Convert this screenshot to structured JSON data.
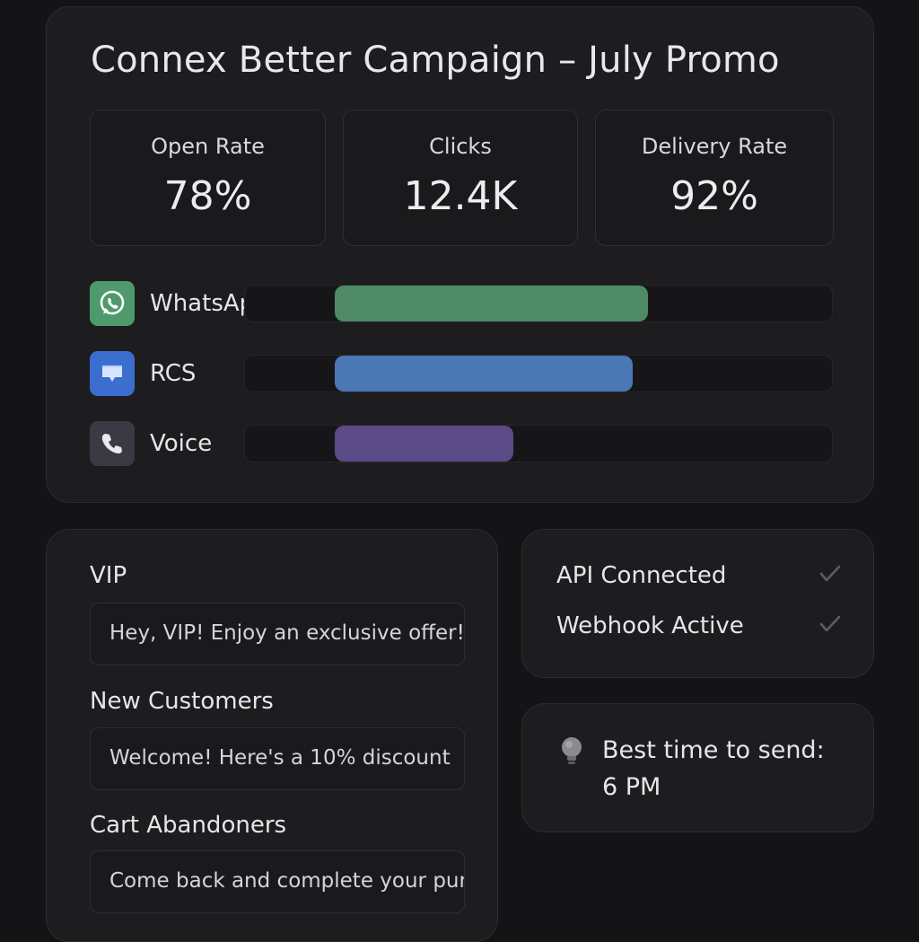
{
  "campaign": {
    "title": "Connex Better Campaign – July Promo",
    "stats": [
      {
        "label": "Open Rate",
        "value": "78%"
      },
      {
        "label": "Clicks",
        "value": "12.4K"
      },
      {
        "label": "Delivery Rate",
        "value": "92%"
      }
    ],
    "channels": [
      {
        "label": "WhatsApp",
        "icon": "whatsapp-icon",
        "level": 0.63,
        "color": "#4e8a66",
        "icon_bg": "#4f9a6c"
      },
      {
        "label": "RCS",
        "icon": "rcs-message-icon",
        "level": 0.6,
        "color": "#4b78b4",
        "icon_bg": "#3c6ed0"
      },
      {
        "label": "Voice",
        "icon": "phone-icon",
        "level": 0.36,
        "color": "#5a4a86",
        "icon_bg": "#3a3a44"
      }
    ]
  },
  "segments": [
    {
      "title": "VIP",
      "message": "Hey, VIP! Enjoy an exclusive offer!"
    },
    {
      "title": "New Customers",
      "message": "Welcome! Here's a 10% discount"
    },
    {
      "title": "Cart Abandoners",
      "message": "Come back and complete your purchase"
    }
  ],
  "status": [
    {
      "label": "API Connected",
      "icon": "checkmark-icon"
    },
    {
      "label": "Webhook Active",
      "icon": "checkmark-icon"
    }
  ],
  "tip": {
    "icon": "lightbulb-icon",
    "line1": "Best time to send:",
    "line2": "6 PM"
  }
}
